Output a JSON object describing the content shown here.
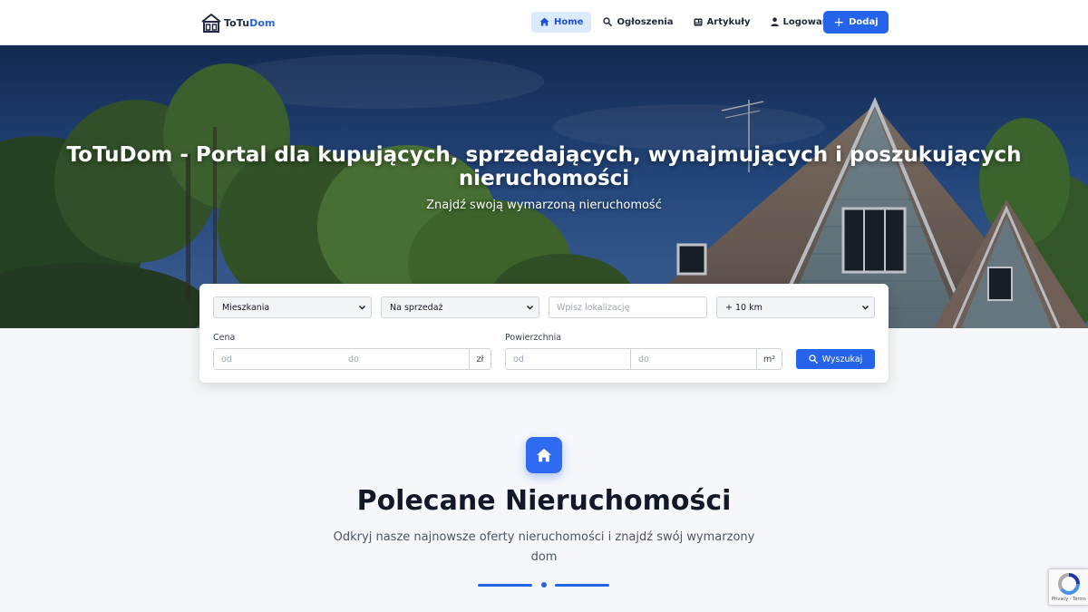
{
  "brand": {
    "part1": "ToTu",
    "part2": "Dom"
  },
  "nav": {
    "home": "Home",
    "listings": "Ogłoszenia",
    "articles": "Artykuły",
    "login": "Logowanie",
    "add": "Dodaj"
  },
  "hero": {
    "title": "ToTuDom - Portal dla kupujących, sprzedających, wynajmujących i poszukujących nieruchomości",
    "subtitle": "Znajdź swoją wymarzoną nieruchomość"
  },
  "search": {
    "property_type": "Mieszkania",
    "transaction": "Na sprzedaż",
    "location_placeholder": "Wpisz lokalizację",
    "radius": "+ 10 km",
    "price_label": "Cena",
    "price_from_placeholder": "od",
    "price_to_placeholder": "do",
    "price_unit": "zł",
    "area_label": "Powierzchnia",
    "area_from_placeholder": "od",
    "area_to_placeholder": "do",
    "area_unit": "m²",
    "button": "Wyszukaj"
  },
  "featured": {
    "title": "Polecane Nieruchomości",
    "description": "Odkryj nasze najnowsze oferty nieruchomości i znajdź swój wymarzony dom"
  },
  "recaptcha": {
    "terms": "Privacy - Terms"
  },
  "colors": {
    "accent": "#2563eb",
    "accent_light": "#dbeafe"
  }
}
